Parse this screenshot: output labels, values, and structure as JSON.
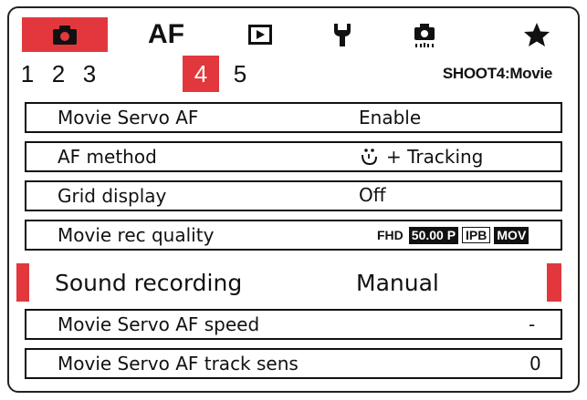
{
  "tabs": [
    {
      "id": "shooting",
      "icon": "camera-icon",
      "label": "",
      "active": true
    },
    {
      "id": "af",
      "icon": "",
      "label": "AF",
      "active": false
    },
    {
      "id": "playback",
      "icon": "play-icon",
      "label": "",
      "active": false
    },
    {
      "id": "setup",
      "icon": "wrench-icon",
      "label": "",
      "active": false
    },
    {
      "id": "custom",
      "icon": "custom-camera-icon",
      "label": "",
      "active": false
    },
    {
      "id": "mymenu",
      "icon": "star-icon",
      "label": "",
      "active": false
    }
  ],
  "pages": [
    "1",
    "2",
    "3",
    "4",
    "5"
  ],
  "active_page": "4",
  "page_label": "SHOOT4:Movie",
  "menu": [
    {
      "label": "Movie Servo AF",
      "value": "Enable"
    },
    {
      "label": "AF method",
      "value": "+ Tracking",
      "value_icon": "face-icon"
    },
    {
      "label": "Grid display",
      "value": "Off"
    },
    {
      "label": "Movie rec quality",
      "value": "",
      "badges": {
        "size": "FHD",
        "fps": "50.00 P",
        "compression": "IPB",
        "format": "MOV"
      }
    },
    {
      "label": "Sound recording",
      "value": "Manual",
      "selected": true
    },
    {
      "label": "Movie Servo AF speed",
      "value": "-"
    },
    {
      "label": "Movie Servo AF track sens",
      "value": "0"
    }
  ],
  "colors": {
    "accent": "#e2383d",
    "text": "#111111",
    "background": "#ffffff"
  }
}
